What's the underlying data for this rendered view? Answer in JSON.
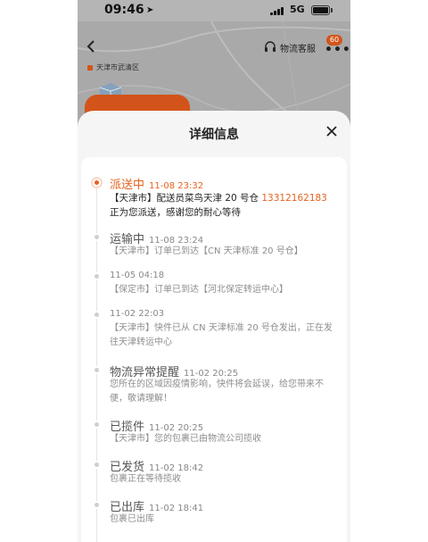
{
  "status_bar": {
    "time": "09:46",
    "network": "5G"
  },
  "header": {
    "customer_service_label": "物流客服",
    "badge_count": "60"
  },
  "map": {
    "origin_label": "天津市武清区"
  },
  "sheet": {
    "title": "详细信息"
  },
  "colors": {
    "accent": "#e8621e",
    "muted": "#8e8e8e"
  },
  "events": [
    {
      "status": "派送中",
      "time": "11-08 23:32",
      "desc_prefix": "【天津市】配送员菜鸟天津 20 号仓 ",
      "phone": "13312162183",
      "desc_suffix": " 正为您派送，感谢您的耐心等待"
    },
    {
      "status": "运输中",
      "time": "11-08 23:24",
      "desc": "【天津市】订单已到达【CN 天津标准 20 号仓】"
    },
    {
      "time": "11-05 04:18",
      "desc": "【保定市】订单已到达【河北保定转运中心】"
    },
    {
      "time": "11-02 22:03",
      "desc": "【天津市】快件已从 CN 天津标准 20 号仓发出，正在发往天津转运中心"
    },
    {
      "status": "物流异常提醒",
      "time": "11-02 20:25",
      "desc": "您所在的区域因疫情影响，快件将会延误，给您带来不便，敬请理解！"
    },
    {
      "status": "已揽件",
      "time": "11-02 20:25",
      "desc": "【天津市】您的包裹已由物流公司揽收"
    },
    {
      "status": "已发货",
      "time": "11-02 18:42",
      "desc": "包裹正在等待揽收"
    },
    {
      "status": "已出库",
      "time": "11-02 18:41",
      "desc": "包裹已出库"
    }
  ]
}
